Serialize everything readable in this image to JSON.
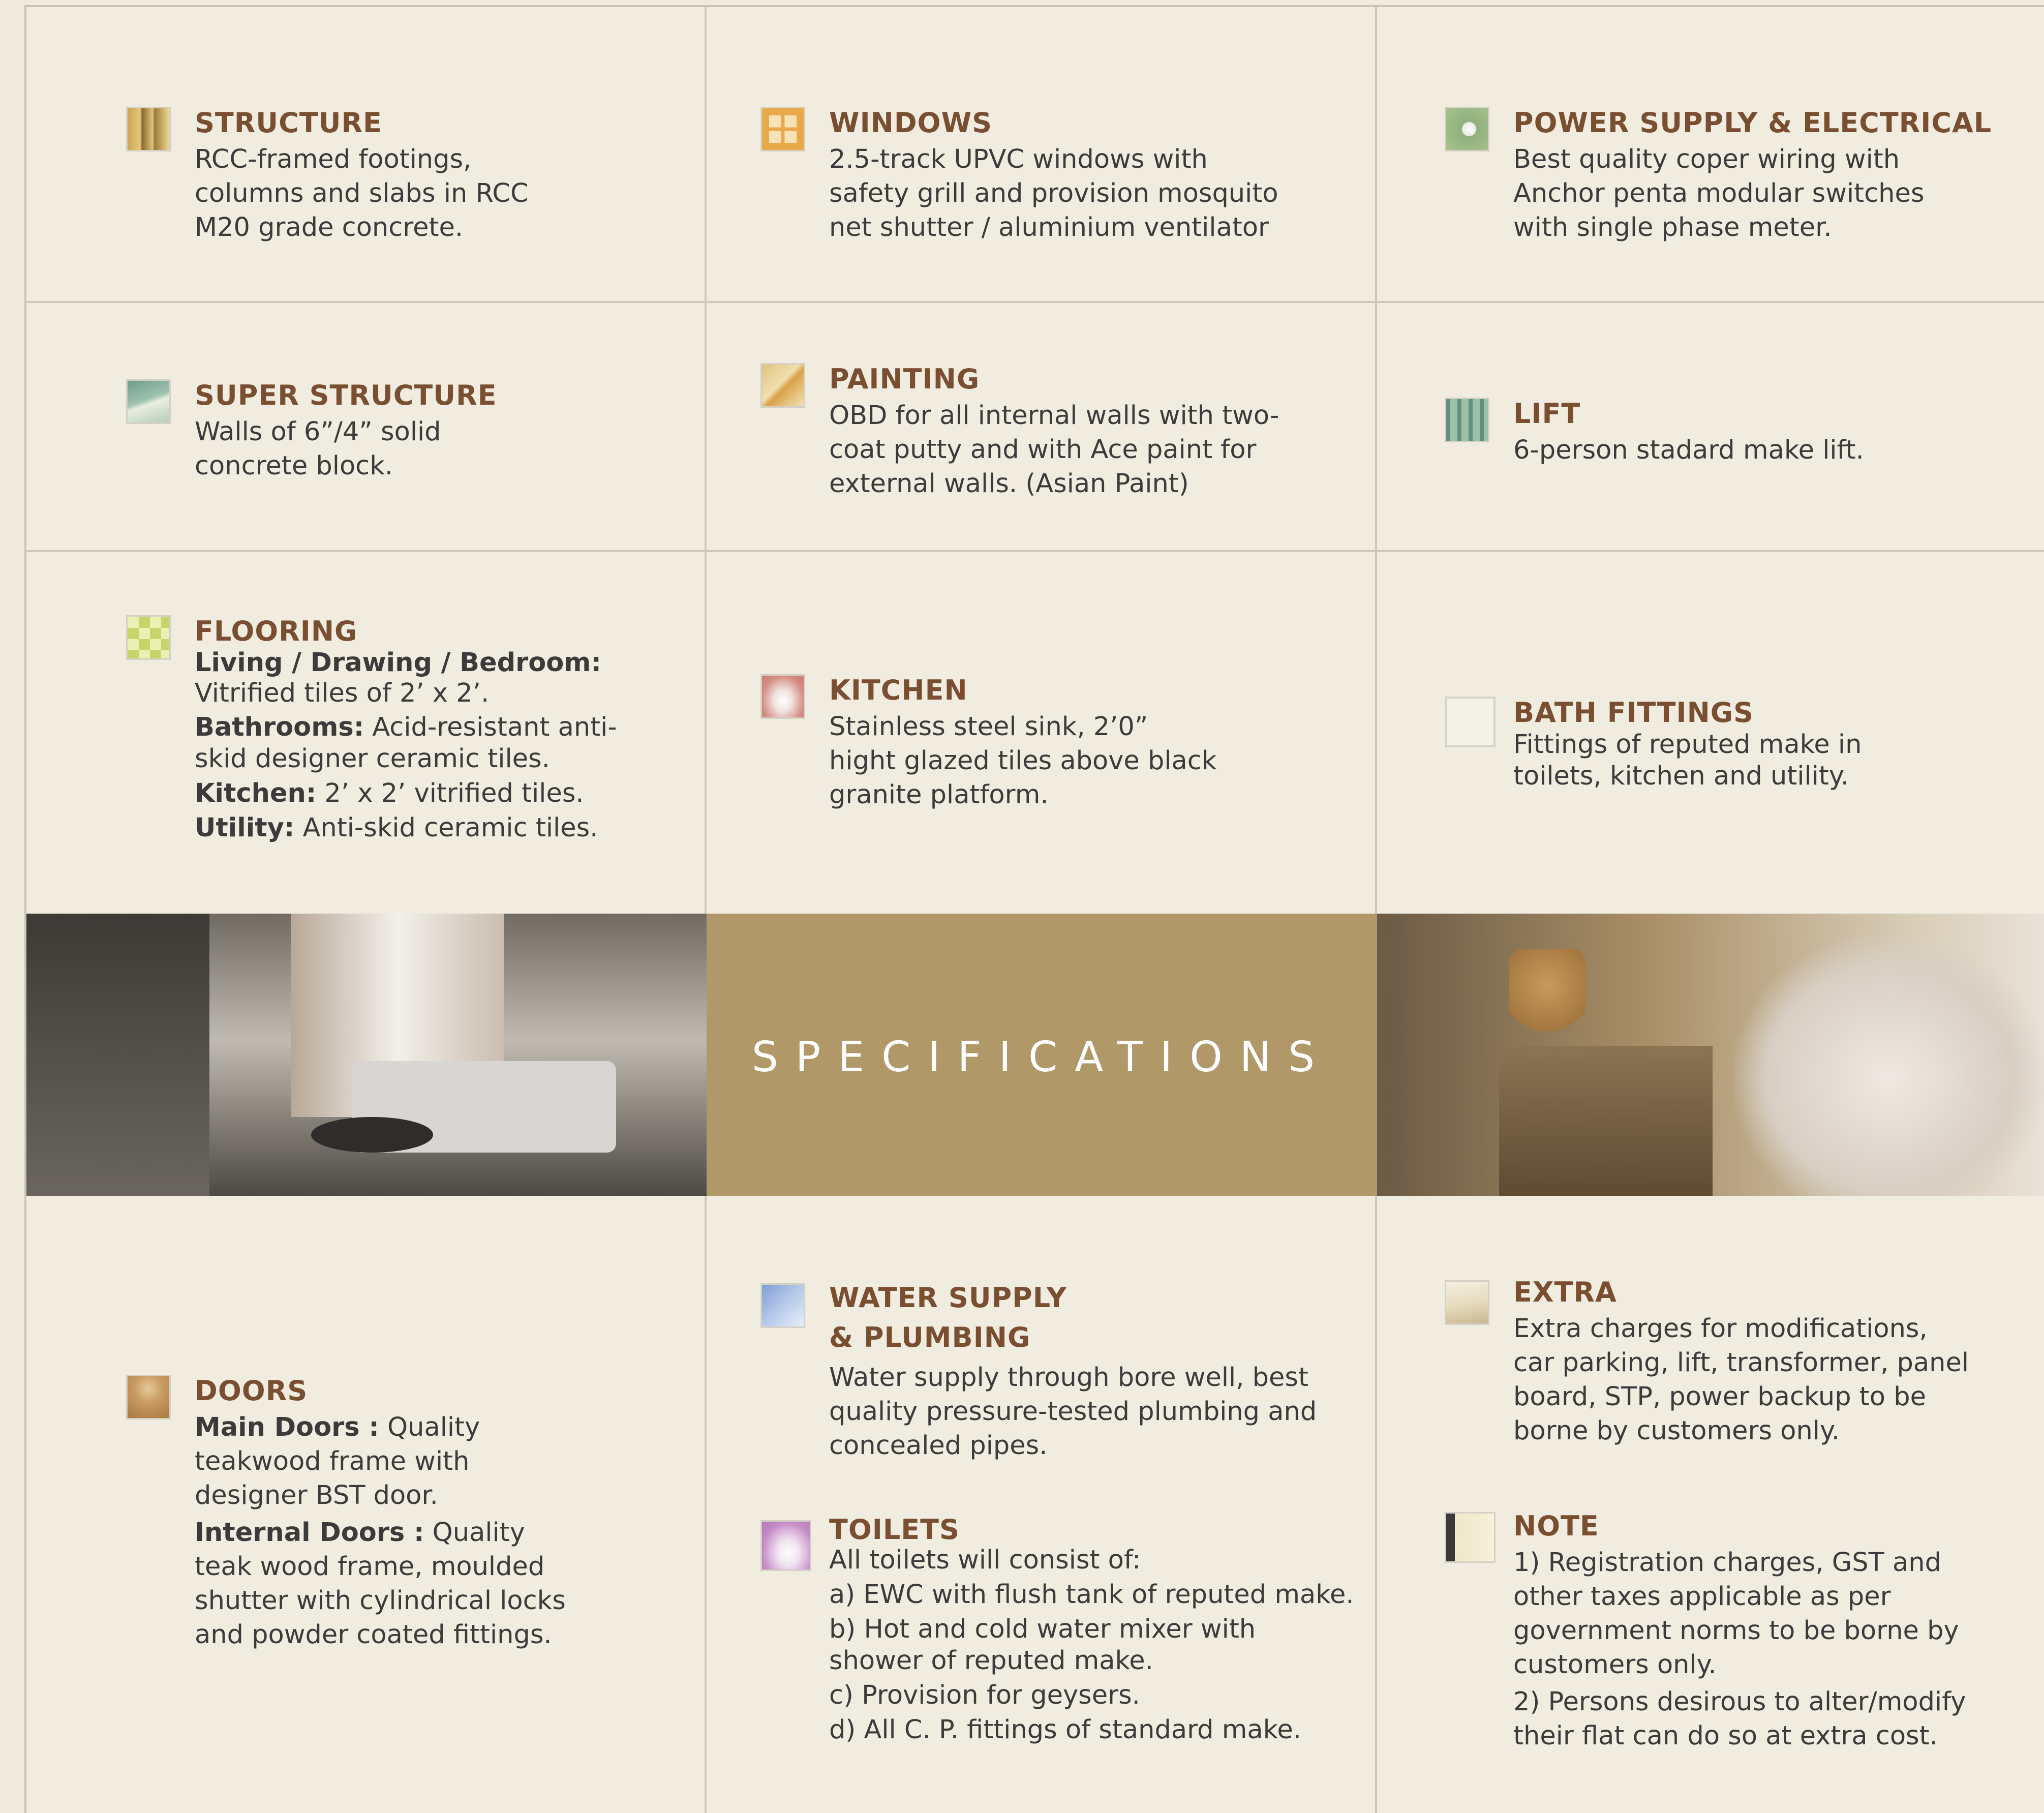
{
  "colors": {
    "background": "#f0ecdf",
    "heading": "#7a4e31",
    "body": "#3b3b3b",
    "banner": "#b09868"
  },
  "banner": {
    "title": "SPECIFICATIONS"
  },
  "sections": {
    "structure": {
      "icon": "pillar-icon",
      "title": "STRUCTURE",
      "lines": [
        "RCC-framed footings,",
        "columns and slabs in RCC",
        "M20 grade concrete."
      ]
    },
    "windows": {
      "icon": "window-icon",
      "title": "WINDOWS",
      "lines": [
        "2.5-track UPVC windows with",
        "safety grill and provision mosquito",
        "net shutter / aluminium ventilator"
      ]
    },
    "power": {
      "icon": "electrical-icon",
      "title": "POWER SUPPLY & ELECTRICAL",
      "lines": [
        "Best quality coper wiring with",
        "Anchor penta modular switches",
        "with single phase meter."
      ]
    },
    "super_structure": {
      "icon": "wall-icon",
      "title": "SUPER STRUCTURE",
      "lines": [
        "Walls of 6”/4” solid",
        "concrete block."
      ]
    },
    "painting": {
      "icon": "paint-brush-icon",
      "title": "PAINTING",
      "lines": [
        "OBD for all internal walls with two-",
        "coat putty and with Ace paint for",
        "external walls. (Asian Paint)"
      ]
    },
    "lift": {
      "icon": "lift-icon",
      "title": "LIFT",
      "lines": [
        "6-person stadard make lift."
      ]
    },
    "flooring": {
      "icon": "tile-icon",
      "title": "FLOORING",
      "living_label": "Living / Drawing / Bedroom:",
      "living_text": "Vitrified tiles of 2’ x 2’.",
      "bath_label": "Bathrooms:",
      "bath_text": " Acid-resistant anti-",
      "bath_text2": "skid designer ceramic tiles.",
      "kitchen_label": "Kitchen:",
      "kitchen_text": " 2’ x 2’ vitrified tiles.",
      "utility_label": "Utility:",
      "utility_text": " Anti-skid ceramic tiles."
    },
    "kitchen": {
      "icon": "chimney-icon",
      "title": "KITCHEN",
      "lines": [
        "Stainless steel sink, 2’0”",
        "hight glazed tiles above black",
        "granite platform."
      ]
    },
    "bath": {
      "icon": "bath-fittings-icon",
      "title": "BATH FITTINGS",
      "lines": [
        "Fittings of reputed make in",
        "toilets, kitchen and utility."
      ]
    },
    "doors": {
      "icon": "door-icon",
      "title": "DOORS",
      "main_label": "Main Doors :",
      "main_lines": [
        " Quality",
        "teakwood frame with",
        "designer BST door."
      ],
      "internal_label": "Internal Doors :",
      "internal_lines": [
        " Quality",
        "teak wood frame, moulded",
        "shutter with cylindrical locks",
        "and powder coated fittings."
      ]
    },
    "water": {
      "icon": "pipe-icon",
      "title_line1": "WATER SUPPLY",
      "title_line2": "& PLUMBING",
      "lines": [
        "Water supply through bore well, best",
        "quality pressure-tested plumbing and",
        "concealed pipes."
      ]
    },
    "toilets": {
      "icon": "toilet-icon",
      "title": "TOILETS",
      "intro": "All toilets will consist of:",
      "items": [
        "a) EWC with flush tank of reputed make.",
        "b) Hot and cold water mixer with",
        "shower of reputed make.",
        "c) Provision for geysers.",
        "d) All C. P. fittings of standard make."
      ]
    },
    "extra": {
      "icon": "extra-icon",
      "title": "EXTRA",
      "lines": [
        "Extra charges for modifications,",
        "car parking, lift, transformer, panel",
        "board, STP, power backup to be",
        "borne by customers only."
      ]
    },
    "note": {
      "icon": "note-icon",
      "title": "NOTE",
      "lines1": [
        "1) Registration charges, GST and",
        "other taxes applicable as per",
        "government norms to be borne by",
        "customers only."
      ],
      "lines2": [
        "2) Persons desirous to alter/modify",
        "their flat can do so at extra cost."
      ]
    }
  }
}
